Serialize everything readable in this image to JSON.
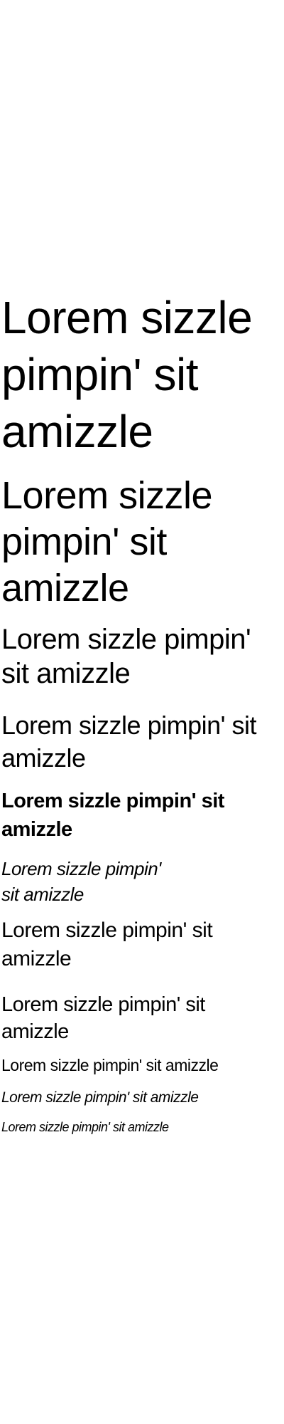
{
  "samples": [
    {
      "text": "Lorem sizzle pimpin' sit amizzle"
    },
    {
      "text": "Lorem sizzle pimpin' sit amizzle"
    },
    {
      "text": "Lorem sizzle pimpin' sit amizzle"
    },
    {
      "text": "Lorem sizzle pimpin' sit amizzle"
    },
    {
      "text": "Lorem sizzle pimpin' sit amizzle"
    },
    {
      "text": "Lorem sizzle pimpin' sit amizzle"
    },
    {
      "text": "Lorem sizzle pimpin' sit amizzle"
    },
    {
      "text": "Lorem sizzle pimpin' sit amizzle"
    },
    {
      "text": "Lorem sizzle pimpin' sit amizzle"
    },
    {
      "text": "Lorem sizzle pimpin' sit amizzle"
    },
    {
      "text": "Lorem sizzle pimpin' sit amizzle"
    }
  ]
}
